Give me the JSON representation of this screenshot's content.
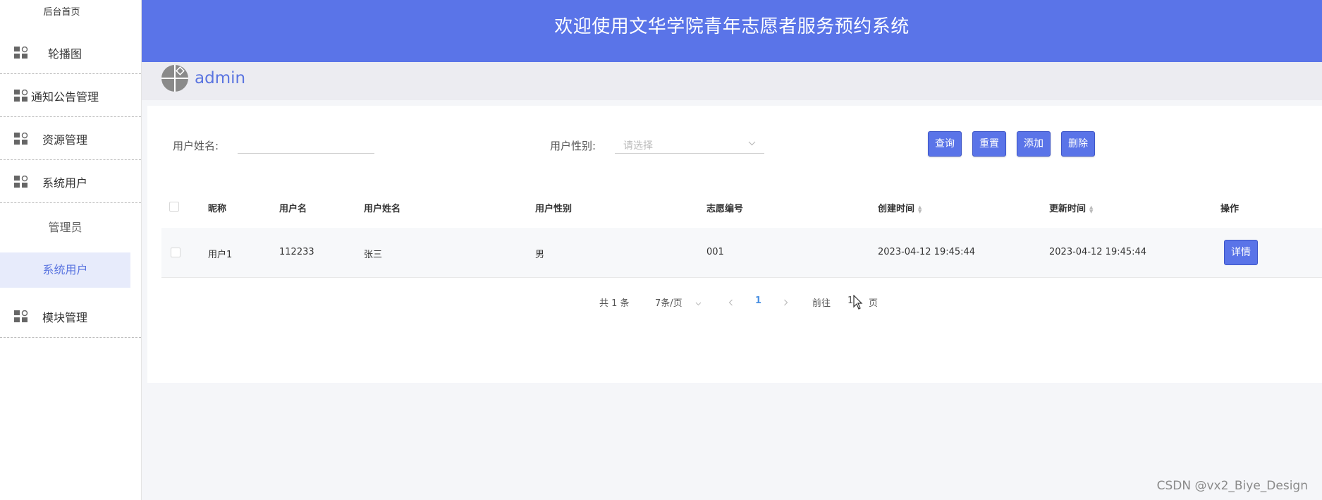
{
  "sidebar": {
    "home": "后台首页",
    "items": [
      {
        "label": "轮播图",
        "icon": "grid-icon"
      },
      {
        "label": "通知公告管理",
        "icon": "grid-icon"
      },
      {
        "label": "资源管理",
        "icon": "grid-icon"
      },
      {
        "label": "系统用户",
        "icon": "grid-icon"
      },
      {
        "label": "模块管理",
        "icon": "grid-icon"
      }
    ],
    "sub_items": [
      {
        "label": "管理员",
        "active": false
      },
      {
        "label": "系统用户",
        "active": true
      }
    ]
  },
  "header": {
    "title": "欢迎使用文华学院青年志愿者服务预约系统"
  },
  "userbar": {
    "username": "admin"
  },
  "filters": {
    "name_label": "用户姓名:",
    "name_value": "",
    "gender_label": "用户性别:",
    "gender_placeholder": "请选择"
  },
  "buttons": {
    "search": "查询",
    "reset": "重置",
    "add": "添加",
    "delete": "删除"
  },
  "table": {
    "headers": [
      "昵称",
      "用户名",
      "用户姓名",
      "用户性别",
      "志愿编号",
      "创建时间",
      "更新时间",
      "操作"
    ],
    "rows": [
      {
        "nickname": "用户1",
        "username": "112233",
        "realname": "张三",
        "gender": "男",
        "volunteer_no": "001",
        "created": "2023-04-12 19:45:44",
        "updated": "2023-04-12 19:45:44",
        "action": "详情"
      }
    ]
  },
  "pagination": {
    "total": "共 1 条",
    "page_size": "7条/页",
    "current_page": "1",
    "goto_label": "前往",
    "goto_value": "1",
    "page_suffix": "页"
  },
  "watermark": "CSDN @vx2_Biye_Design",
  "colors": {
    "primary": "#5a74e8",
    "header_bg": "#5a74e8",
    "active_menu_bg": "#e7ebfb"
  }
}
